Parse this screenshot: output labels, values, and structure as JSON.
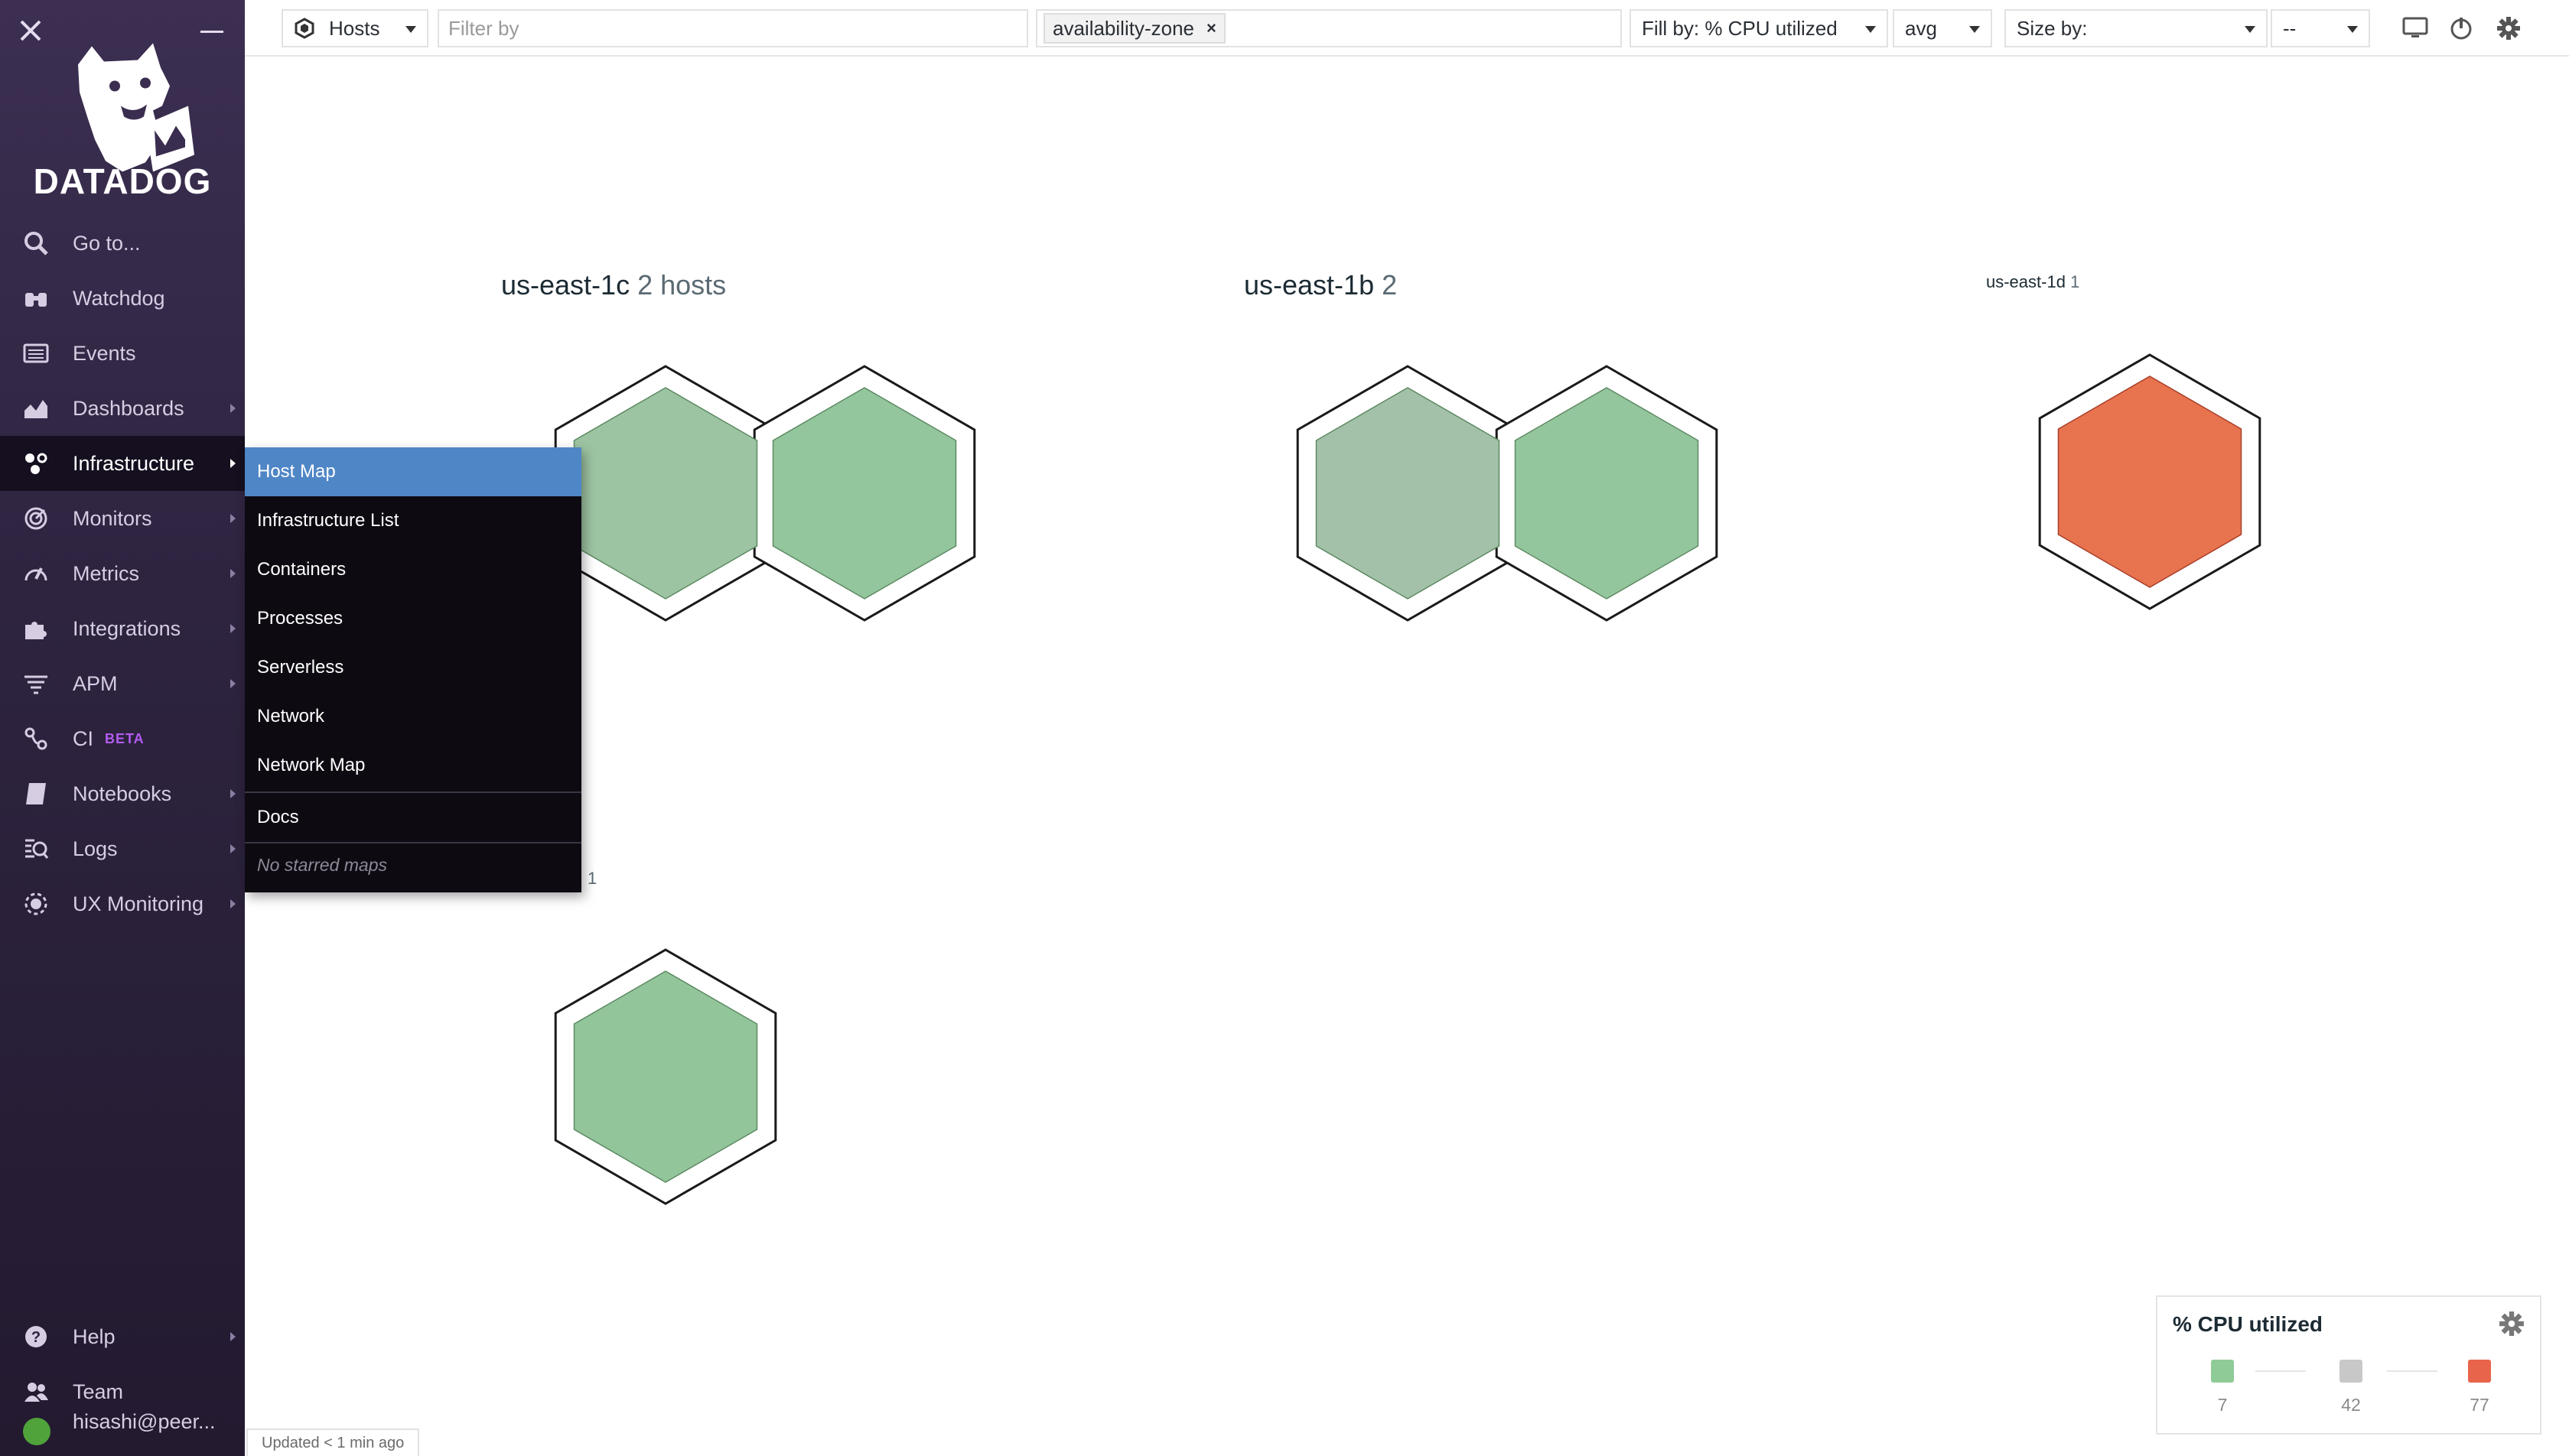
{
  "sidebar": {
    "logo_text": "DATADOG",
    "items": [
      {
        "label": "Go to...",
        "icon": "search-icon"
      },
      {
        "label": "Watchdog",
        "icon": "binoculars-icon"
      },
      {
        "label": "Events",
        "icon": "events-list-icon"
      },
      {
        "label": "Dashboards",
        "icon": "dashboards-chart-icon"
      },
      {
        "label": "Infrastructure",
        "icon": "infrastructure-icon"
      },
      {
        "label": "Monitors",
        "icon": "monitors-icon"
      },
      {
        "label": "Metrics",
        "icon": "metrics-gauge-icon"
      },
      {
        "label": "Integrations",
        "icon": "puzzle-icon"
      },
      {
        "label": "APM",
        "icon": "apm-icon"
      },
      {
        "label": "CI",
        "icon": "ci-icon",
        "badge": "BETA"
      },
      {
        "label": "Notebooks",
        "icon": "notebook-icon"
      },
      {
        "label": "Logs",
        "icon": "logs-icon"
      },
      {
        "label": "UX Monitoring",
        "icon": "ux-monitoring-icon"
      }
    ],
    "bottom": [
      {
        "label": "Help",
        "icon": "help-icon"
      },
      {
        "label": "Team",
        "icon": "team-icon"
      },
      {
        "label": "hisashi@peer...",
        "icon": "user-avatar"
      }
    ]
  },
  "flyout": {
    "items": [
      "Host Map",
      "Infrastructure List",
      "Containers",
      "Processes",
      "Serverless",
      "Network",
      "Network Map"
    ],
    "docs": "Docs",
    "empty_text": "No starred maps"
  },
  "toolbar": {
    "type_select": "Hosts",
    "filter_placeholder": "Filter by",
    "group_tag": "availability-zone",
    "fill_by": "Fill by: % CPU utilized",
    "fill_agg": "avg",
    "size_by": "Size by:",
    "size_agg": "--"
  },
  "groups": [
    {
      "name": "us-east-1c",
      "count": "2 hosts"
    },
    {
      "name": "us-east-1b",
      "count": "2"
    },
    {
      "name": "us-east-1d",
      "count": "1"
    },
    {
      "name": "",
      "count": "1"
    }
  ],
  "hosts": [
    {
      "group": "us-east-1c",
      "color": "#9dc4a2"
    },
    {
      "group": "us-east-1c",
      "color": "#94c69d"
    },
    {
      "group": "us-east-1b",
      "color": "#a3c1a8"
    },
    {
      "group": "us-east-1b",
      "color": "#94c69d"
    },
    {
      "group": "us-east-1d",
      "color": "#e8734f"
    },
    {
      "group": "",
      "color": "#92c59a"
    }
  ],
  "legend": {
    "title": "% CPU utilized",
    "stops": [
      {
        "value": "7",
        "color": "#8fcb96"
      },
      {
        "value": "42",
        "color": "#c8c8c8"
      },
      {
        "value": "77",
        "color": "#e8644a"
      }
    ]
  },
  "status": "Updated < 1 min ago"
}
